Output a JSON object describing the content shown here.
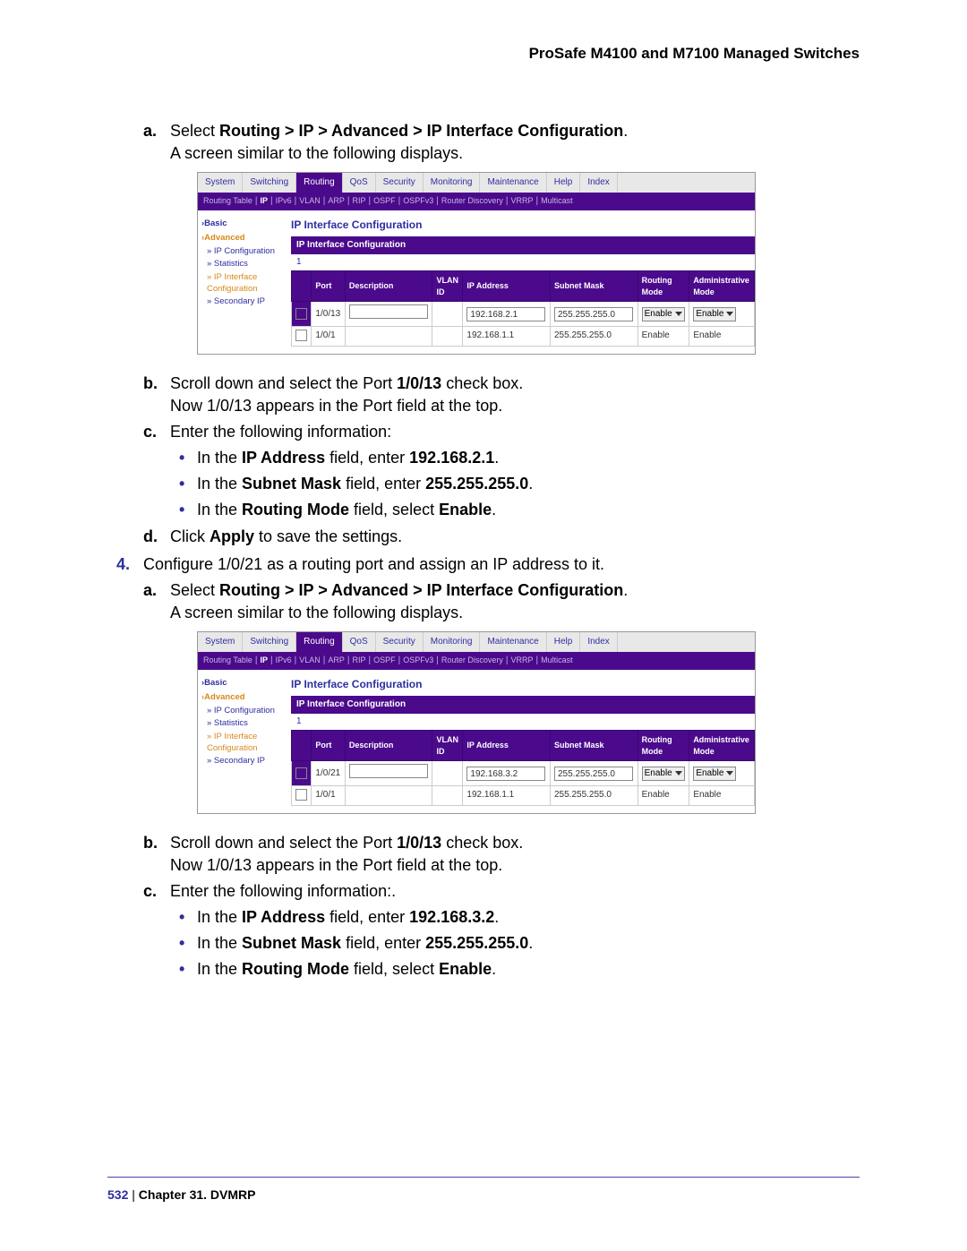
{
  "header": "ProSafe M4100 and M7100 Managed Switches",
  "content": {
    "step_a_label": "a.",
    "step_a_pre": "Select ",
    "step_a_bold": "Routing > IP > Advanced > IP Interface Configuration",
    "step_a_post": ".",
    "step_a_line2": "A screen similar to the following displays.",
    "step_b_label": "b.",
    "step_b_p1": "Scroll down and select the Port ",
    "step_b_bold": "1/0/13",
    "step_b_p2": " check box.",
    "step_b_line2": "Now 1/0/13 appears in the Port field at the top.",
    "step_c_label": "c.",
    "step_c_text": "Enter the following information:",
    "step_c_b1_p1": "In the ",
    "step_c_b1_b1": "IP Address",
    "step_c_b1_p2": " field, enter ",
    "step_c_b1_b2": "192.168.2.1",
    "step_c_b1_p3": ".",
    "step_c_b2_p1": "In the ",
    "step_c_b2_b1": "Subnet Mask",
    "step_c_b2_p2": " field, enter ",
    "step_c_b2_b2": "255.255.255.0",
    "step_c_b2_p3": ".",
    "step_c_b3_p1": "In the ",
    "step_c_b3_b1": "Routing Mode",
    "step_c_b3_p2": " field, select ",
    "step_c_b3_b2": "Enable",
    "step_c_b3_p3": ".",
    "step_d_label": "d.",
    "step_d_p1": "Click ",
    "step_d_bold": "Apply",
    "step_d_p2": " to save the settings.",
    "step4_num": "4.",
    "step4_text": "Configure 1/0/21 as a routing port and assign an IP address to it.",
    "step4a_label": "a.",
    "step4a_pre": "Select ",
    "step4a_bold": "Routing > IP > Advanced > IP Interface Configuration",
    "step4a_post": ".",
    "step4a_line2": "A screen similar to the following displays.",
    "step4b_label": "b.",
    "step4b_p1": "Scroll down and select the Port ",
    "step4b_bold": "1/0/13",
    "step4b_p2": " check box.",
    "step4b_line2": "Now 1/0/13 appears in the Port field at the top.",
    "step4c_label": "c.",
    "step4c_text": "Enter the following information:.",
    "step4c_b1_p1": "In the ",
    "step4c_b1_b1": "IP Address",
    "step4c_b1_p2": " field, enter ",
    "step4c_b1_b2": "192.168.3.2",
    "step4c_b1_p3": ".",
    "step4c_b2_p1": "In the ",
    "step4c_b2_b1": "Subnet Mask",
    "step4c_b2_p2": " field, enter ",
    "step4c_b2_b2": "255.255.255.0",
    "step4c_b2_p3": ".",
    "step4c_b3_p1": "In the ",
    "step4c_b3_b1": "Routing Mode",
    "step4c_b3_p2": " field, select ",
    "step4c_b3_b2": "Enable",
    "step4c_b3_p3": "."
  },
  "ui": {
    "tabs": [
      "System",
      "Switching",
      "Routing",
      "QoS",
      "Security",
      "Monitoring",
      "Maintenance",
      "Help",
      "Index"
    ],
    "active_tab": "Routing",
    "subtabs": [
      "Routing Table",
      "IP",
      "IPv6",
      "VLAN",
      "ARP",
      "RIP",
      "OSPF",
      "OSPFv3",
      "Router Discovery",
      "VRRP",
      "Multicast"
    ],
    "active_subtab": "IP",
    "side": {
      "basic": "Basic",
      "advanced": "Advanced",
      "items": [
        "IP Configuration",
        "Statistics",
        "IP Interface Configuration",
        "Secondary IP"
      ]
    },
    "panel_title": "IP Interface Configuration",
    "band_title": "IP Interface Configuration",
    "pager": "1",
    "headers": [
      "",
      "Port",
      "Description",
      "VLAN ID",
      "IP Address",
      "Subnet Mask",
      "Routing Mode",
      "Administrative Mode"
    ],
    "shot1": {
      "rows": [
        {
          "checked": true,
          "port": "1/0/13",
          "desc": "",
          "vlan": "",
          "ip": "192.168.2.1",
          "mask": "255.255.255.0",
          "rmode": "Enable",
          "amode": "Enable",
          "editable": true
        },
        {
          "checked": false,
          "port": "1/0/1",
          "desc": "",
          "vlan": "",
          "ip": "192.168.1.1",
          "mask": "255.255.255.0",
          "rmode": "Enable",
          "amode": "Enable",
          "editable": false
        }
      ]
    },
    "shot2": {
      "rows": [
        {
          "checked": true,
          "port": "1/0/21",
          "desc": "",
          "vlan": "",
          "ip": "192.168.3.2",
          "mask": "255.255.255.0",
          "rmode": "Enable",
          "amode": "Enable",
          "editable": true
        },
        {
          "checked": false,
          "port": "1/0/1",
          "desc": "",
          "vlan": "",
          "ip": "192.168.1.1",
          "mask": "255.255.255.0",
          "rmode": "Enable",
          "amode": "Enable",
          "editable": false
        }
      ]
    }
  },
  "footer": {
    "page": "532",
    "sep": "   |   ",
    "chapter": "Chapter 31.  DVMRP"
  }
}
